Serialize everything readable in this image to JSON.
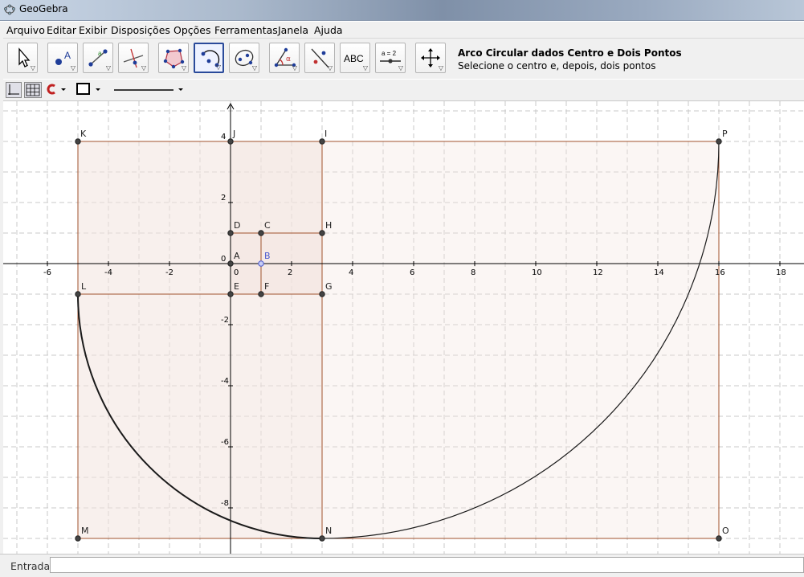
{
  "window": {
    "title": "GeoGebra"
  },
  "menubar": {
    "items": [
      {
        "label": "Arquivo"
      },
      {
        "label": "Editar"
      },
      {
        "label": "Exibir"
      },
      {
        "label": "Disposições"
      },
      {
        "label": "Opções"
      },
      {
        "label": "Ferramentas"
      },
      {
        "label": "Janela"
      },
      {
        "label": "Ajuda"
      }
    ]
  },
  "toolbar": {
    "tools": [
      {
        "icon": "move-arrow-icon"
      },
      {
        "icon": "new-point-icon"
      },
      {
        "icon": "line-segment-icon"
      },
      {
        "icon": "perpendicular-line-icon"
      },
      {
        "icon": "polygon-icon"
      },
      {
        "icon": "circular-arc-icon",
        "selected": true
      },
      {
        "icon": "conic-icon"
      },
      {
        "icon": "angle-icon"
      },
      {
        "icon": "reflect-icon"
      },
      {
        "icon": "text-icon",
        "text": "ABC"
      },
      {
        "icon": "slider-icon",
        "text": "a = 2"
      },
      {
        "icon": "move-graphics-view-icon"
      }
    ],
    "help_title": "Arco Circular dados Centro e Dois Pontos",
    "help_text": "Selecione o centro e, depois, dois pontos"
  },
  "stylebar": {
    "items": [
      "axes-toggle-icon",
      "grid-toggle-icon",
      "point-capture-icon",
      "object-color-icon",
      "line-style-icon"
    ]
  },
  "graphics": {
    "x_ticks": [
      "-6",
      "-4",
      "-2",
      "0",
      "2",
      "4",
      "6",
      "8",
      "10",
      "12",
      "14",
      "16",
      "18"
    ],
    "y_ticks": [
      "4",
      "2",
      "0",
      "-2",
      "-4",
      "-6",
      "-8"
    ],
    "points": [
      "A",
      "B",
      "C",
      "D",
      "E",
      "F",
      "G",
      "H",
      "I",
      "J",
      "K",
      "L",
      "M",
      "N",
      "O",
      "P"
    ],
    "colors": {
      "polygon_fill": "#f4e6e0",
      "polygon_edge": "#a0522d",
      "point": "#444444",
      "point_selected": "#4a5ad0",
      "arc": "#1a1a1a",
      "grid": "#c8c8c8"
    }
  },
  "input": {
    "label": "Entrada:",
    "value": ""
  }
}
